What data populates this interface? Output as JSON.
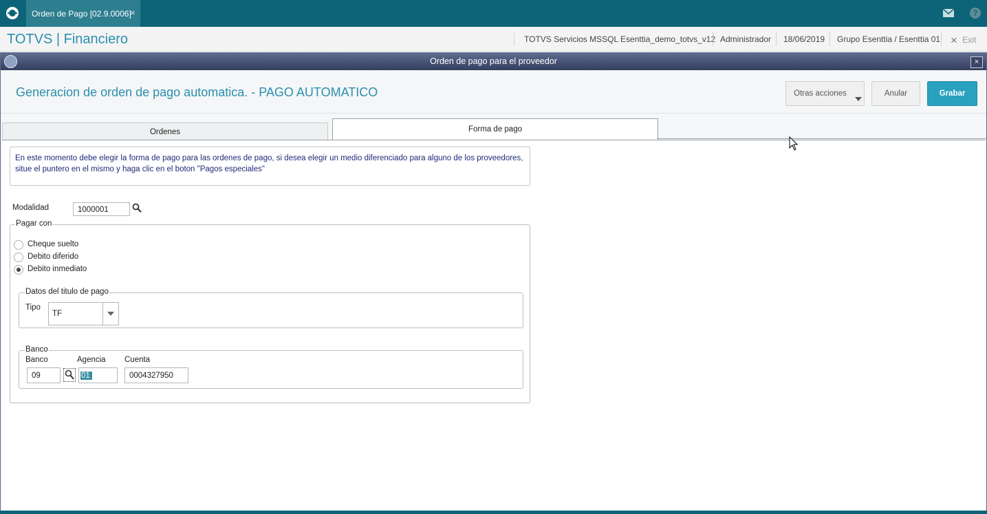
{
  "app": {
    "tab_title": "Orden de Pago [02.9.0006]",
    "tab_close": "×",
    "brand": "TOTVS | Financiero",
    "environment": "TOTVS Servicios MSSQL Esenttia_demo_totvs_v12",
    "user": "Administrador",
    "date": "18/06/2019",
    "company": "Grupo Esenttia / Esenttia 01",
    "exit_label": "Exit",
    "exit_icon": "×"
  },
  "dialog": {
    "title": "Orden de pago para el proveedor",
    "close": "×",
    "page_title": "Generacion de orden de pago automatica. - PAGO AUTOMATICO",
    "buttons": {
      "more": "Otras acciones",
      "cancel": "Anular",
      "save": "Grabar"
    },
    "tabs": [
      "Ordenes",
      "Forma de pago"
    ],
    "info_text": "En este momento debe elegir la forma de pago para las ordenes de pago, si desea elegir un medio diferenciado para alguno de los proveedores, situe el puntero en el mismo y haga clic en el boton \"Pagos especiales\"",
    "modalidad": {
      "label": "Modalidad",
      "value": "1000001"
    },
    "pagar_con": {
      "legend": "Pagar con",
      "options": [
        "Cheque suelto",
        "Debito diferido",
        "Debito inmediato"
      ],
      "selected": "Debito inmediato"
    },
    "titulo": {
      "legend": "Datos del titulo de pago",
      "tipo_label": "Tipo",
      "tipo_value": "TF"
    },
    "banco": {
      "legend": "Banco",
      "banco_label": "Banco",
      "banco_value": "09",
      "agencia_label": "Agencia",
      "agencia_value": "01",
      "cuenta_label": "Cuenta",
      "cuenta_value": "0004327950"
    }
  },
  "colors": {
    "accent": "#29a1bf",
    "topbar": "#0d6478",
    "title_text": "#2b8fae"
  }
}
